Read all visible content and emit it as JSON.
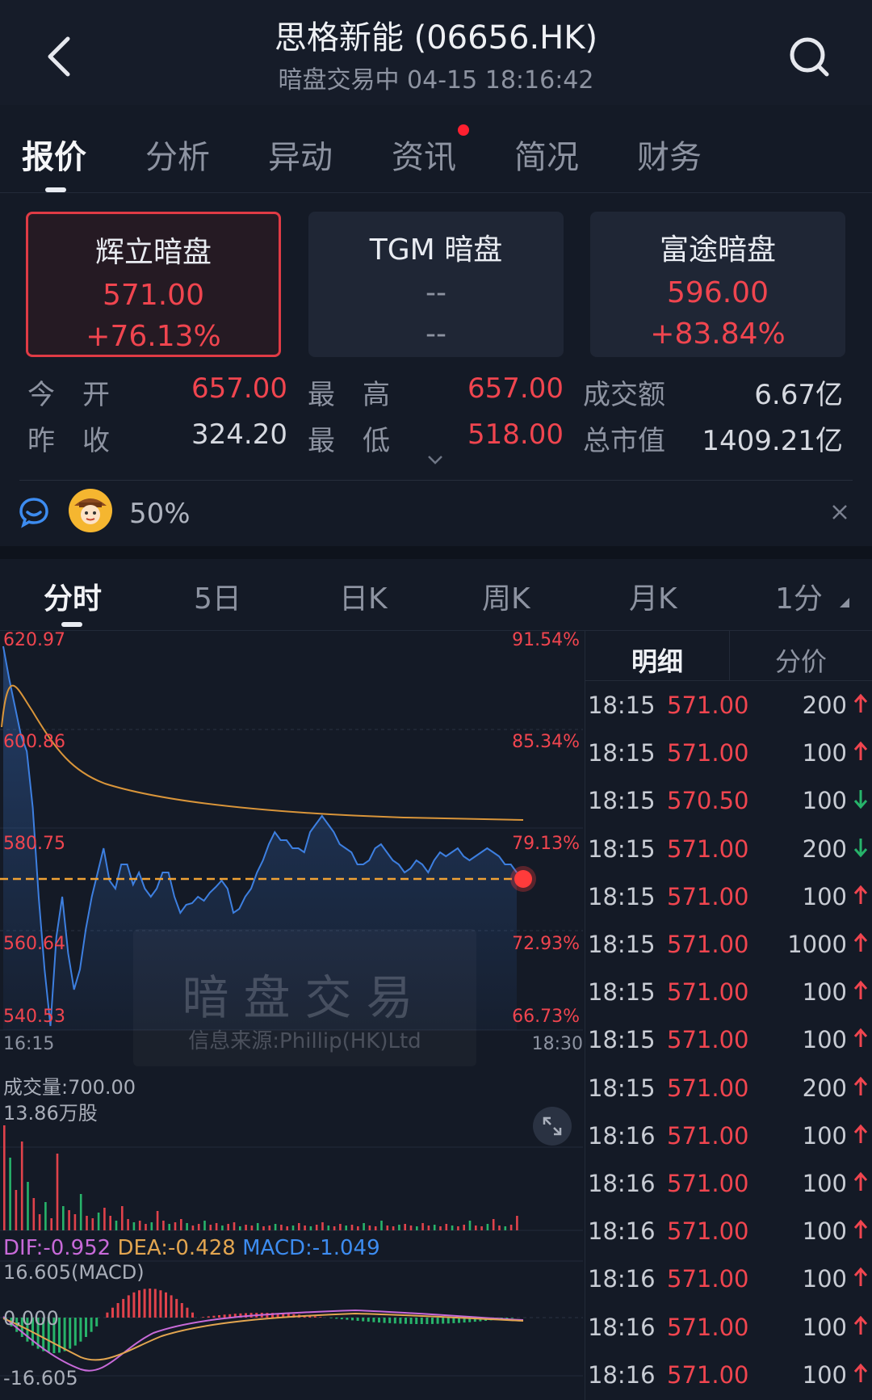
{
  "header": {
    "title": "思格新能 (06656.HK)",
    "subtitle": "暗盘交易中 04-15 18:16:42"
  },
  "tabs": [
    {
      "label": "报价",
      "active": true
    },
    {
      "label": "分析"
    },
    {
      "label": "异动"
    },
    {
      "label": "资讯",
      "badge": true
    },
    {
      "label": "简况"
    },
    {
      "label": "财务"
    }
  ],
  "dark_pools": [
    {
      "name": "辉立暗盘",
      "price": "571.00",
      "change": "+76.13%",
      "selected": true
    },
    {
      "name": "TGM 暗盘",
      "price": "--",
      "change": "--"
    },
    {
      "name": "富途暗盘",
      "price": "596.00",
      "change": "+83.84%"
    }
  ],
  "stats": {
    "open_label": "今　开",
    "open": "657.00",
    "high_label": "最　高",
    "high": "657.00",
    "turnover_label": "成交额",
    "turnover": "6.67亿",
    "prev_label": "昨　收",
    "prev": "324.20",
    "low_label": "最　低",
    "low": "518.00",
    "mcap_label": "总市值",
    "mcap": "1409.21亿"
  },
  "sentiment": {
    "value": "50%"
  },
  "chart_tabs": [
    "分时",
    "5日",
    "日K",
    "周K",
    "月K",
    "1分"
  ],
  "chart": {
    "y_left": [
      "620.97",
      "600.86",
      "580.75",
      "560.64",
      "540.53"
    ],
    "y_right": [
      "91.54%",
      "85.34%",
      "79.13%",
      "72.93%",
      "66.73%"
    ],
    "x_start": "16:15",
    "x_end": "18:30",
    "watermark_title": "暗盘交易",
    "watermark_source": "信息来源:Phillip(HK)Ltd",
    "volume_label": "成交量:700.00",
    "volume_max": "13.86万股",
    "dif": "DIF:-0.952",
    "dea": "DEA:-0.428",
    "macd": "MACD:-1.049",
    "macd_top": "16.605(MACD)",
    "macd_zero": "0.000",
    "macd_bottom": "-16.605"
  },
  "detail": {
    "tab_detail": "明细",
    "tab_price": "分价",
    "rows": [
      {
        "time": "18:15",
        "price": "571.00",
        "vol": "200",
        "dir": "up"
      },
      {
        "time": "18:15",
        "price": "571.00",
        "vol": "100",
        "dir": "up"
      },
      {
        "time": "18:15",
        "price": "570.50",
        "vol": "100",
        "dir": "down"
      },
      {
        "time": "18:15",
        "price": "571.00",
        "vol": "200",
        "dir": "down"
      },
      {
        "time": "18:15",
        "price": "571.00",
        "vol": "100",
        "dir": "up"
      },
      {
        "time": "18:15",
        "price": "571.00",
        "vol": "1000",
        "dir": "up"
      },
      {
        "time": "18:15",
        "price": "571.00",
        "vol": "100",
        "dir": "up"
      },
      {
        "time": "18:15",
        "price": "571.00",
        "vol": "100",
        "dir": "up"
      },
      {
        "time": "18:15",
        "price": "571.00",
        "vol": "200",
        "dir": "up"
      },
      {
        "time": "18:16",
        "price": "571.00",
        "vol": "100",
        "dir": "up"
      },
      {
        "time": "18:16",
        "price": "571.00",
        "vol": "100",
        "dir": "up"
      },
      {
        "time": "18:16",
        "price": "571.00",
        "vol": "100",
        "dir": "up"
      },
      {
        "time": "18:16",
        "price": "571.00",
        "vol": "100",
        "dir": "up"
      },
      {
        "time": "18:16",
        "price": "571.00",
        "vol": "100",
        "dir": "up"
      },
      {
        "time": "18:16",
        "price": "571.00",
        "vol": "100",
        "dir": "up"
      }
    ]
  },
  "colors": {
    "up": "#f0454f",
    "down": "#27b36a",
    "price_line": "#3d7fe0",
    "avg_line": "#d9953a",
    "accent": "#e03b45"
  }
}
